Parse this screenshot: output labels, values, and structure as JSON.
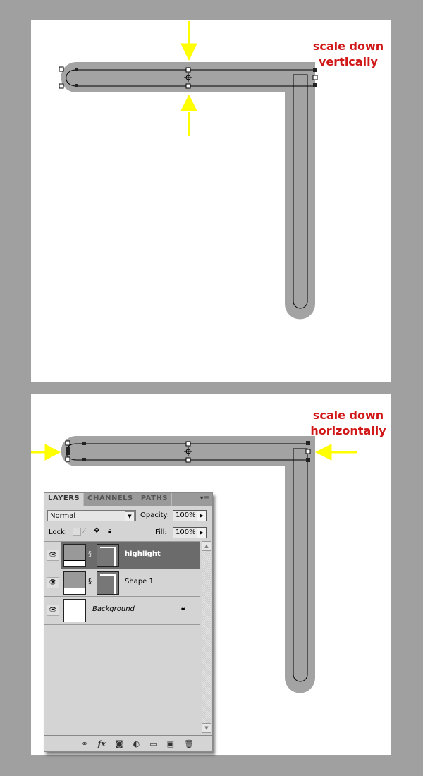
{
  "annotations": {
    "top": [
      "scale down",
      "vertically"
    ],
    "bottom": [
      "scale down",
      "horizontally"
    ]
  },
  "colors": {
    "background": "#a0a0a0",
    "shape": "#a3a3a3",
    "arrow": "#ffff00",
    "annotation": "#d01818"
  },
  "layers_panel": {
    "tabs": [
      "LAYERS",
      "CHANNELS",
      "PATHS"
    ],
    "blend_mode": "Normal",
    "opacity_label": "Opacity:",
    "opacity": "100%",
    "lock_label": "Lock:",
    "fill_label": "Fill:",
    "fill": "100%",
    "layers": [
      {
        "name": "highlight",
        "selected": true
      },
      {
        "name": "Shape 1",
        "selected": false
      },
      {
        "name": "Background",
        "selected": false,
        "locked": true
      }
    ],
    "bottom_icons": [
      "link-icon",
      "fx-icon",
      "mask-icon",
      "adjustment-icon",
      "folder-icon",
      "new-layer-icon",
      "trash-icon"
    ]
  }
}
